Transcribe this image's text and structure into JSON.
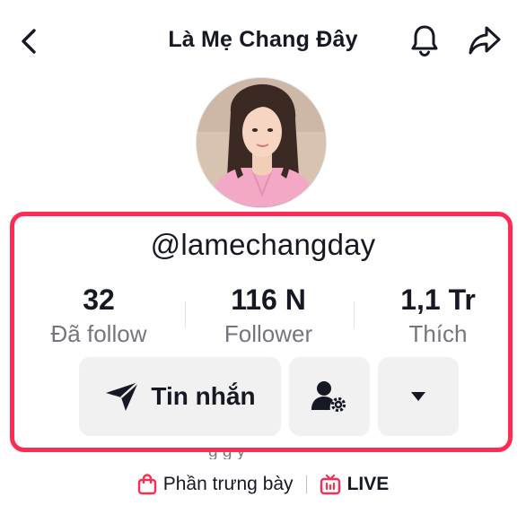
{
  "header": {
    "title": "Là Mẹ Chang Đây",
    "back_icon": "chevron-left-icon",
    "notification_icon": "bell-icon",
    "share_icon": "share-arrow-icon"
  },
  "profile": {
    "username": "@lamechangday",
    "stats": [
      {
        "value": "32",
        "label": "Đã follow"
      },
      {
        "value": "116 N",
        "label": "Follower"
      },
      {
        "value": "1,1 Tr",
        "label": "Thích"
      }
    ]
  },
  "actions": {
    "message_label": "Tin nhắn",
    "message_icon": "send-icon",
    "follow_settings_icon": "user-settings-icon",
    "more_icon": "caret-down-icon"
  },
  "bio_partial": "g g y",
  "links": {
    "showcase_label": "Phần trưng bày",
    "showcase_icon": "shopping-bag-icon",
    "live_label": "LIVE",
    "live_icon": "live-tv-icon"
  },
  "colors": {
    "highlight": "#fe2c55",
    "button_bg": "#f1f1f2",
    "text_primary": "#161823",
    "text_secondary": "#75767d"
  }
}
